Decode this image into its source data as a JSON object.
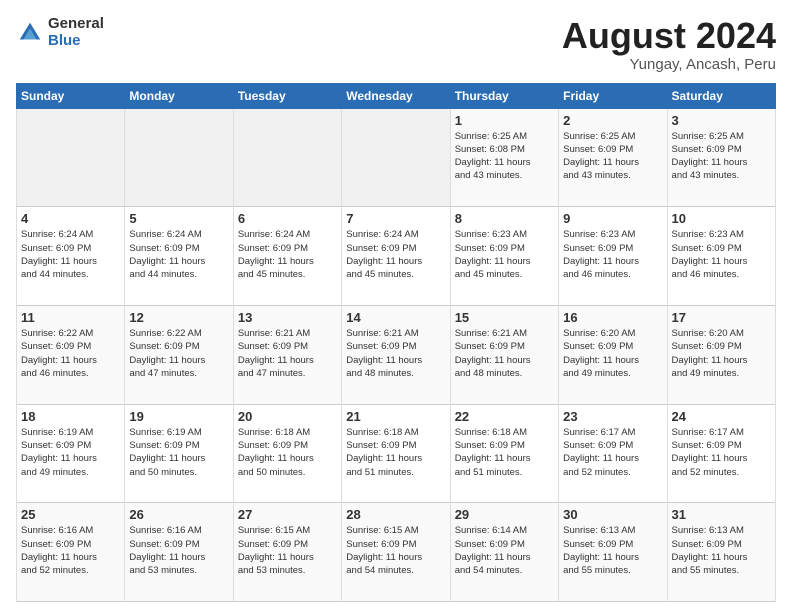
{
  "header": {
    "logo_general": "General",
    "logo_blue": "Blue",
    "main_title": "August 2024",
    "subtitle": "Yungay, Ancash, Peru"
  },
  "calendar": {
    "days_of_week": [
      "Sunday",
      "Monday",
      "Tuesday",
      "Wednesday",
      "Thursday",
      "Friday",
      "Saturday"
    ],
    "weeks": [
      [
        {
          "day": "",
          "info": "",
          "empty": true
        },
        {
          "day": "",
          "info": "",
          "empty": true
        },
        {
          "day": "",
          "info": "",
          "empty": true
        },
        {
          "day": "",
          "info": "",
          "empty": true
        },
        {
          "day": "1",
          "info": "Sunrise: 6:25 AM\nSunset: 6:08 PM\nDaylight: 11 hours\nand 43 minutes.",
          "empty": false
        },
        {
          "day": "2",
          "info": "Sunrise: 6:25 AM\nSunset: 6:09 PM\nDaylight: 11 hours\nand 43 minutes.",
          "empty": false
        },
        {
          "day": "3",
          "info": "Sunrise: 6:25 AM\nSunset: 6:09 PM\nDaylight: 11 hours\nand 43 minutes.",
          "empty": false
        }
      ],
      [
        {
          "day": "4",
          "info": "Sunrise: 6:24 AM\nSunset: 6:09 PM\nDaylight: 11 hours\nand 44 minutes.",
          "empty": false
        },
        {
          "day": "5",
          "info": "Sunrise: 6:24 AM\nSunset: 6:09 PM\nDaylight: 11 hours\nand 44 minutes.",
          "empty": false
        },
        {
          "day": "6",
          "info": "Sunrise: 6:24 AM\nSunset: 6:09 PM\nDaylight: 11 hours\nand 45 minutes.",
          "empty": false
        },
        {
          "day": "7",
          "info": "Sunrise: 6:24 AM\nSunset: 6:09 PM\nDaylight: 11 hours\nand 45 minutes.",
          "empty": false
        },
        {
          "day": "8",
          "info": "Sunrise: 6:23 AM\nSunset: 6:09 PM\nDaylight: 11 hours\nand 45 minutes.",
          "empty": false
        },
        {
          "day": "9",
          "info": "Sunrise: 6:23 AM\nSunset: 6:09 PM\nDaylight: 11 hours\nand 46 minutes.",
          "empty": false
        },
        {
          "day": "10",
          "info": "Sunrise: 6:23 AM\nSunset: 6:09 PM\nDaylight: 11 hours\nand 46 minutes.",
          "empty": false
        }
      ],
      [
        {
          "day": "11",
          "info": "Sunrise: 6:22 AM\nSunset: 6:09 PM\nDaylight: 11 hours\nand 46 minutes.",
          "empty": false
        },
        {
          "day": "12",
          "info": "Sunrise: 6:22 AM\nSunset: 6:09 PM\nDaylight: 11 hours\nand 47 minutes.",
          "empty": false
        },
        {
          "day": "13",
          "info": "Sunrise: 6:21 AM\nSunset: 6:09 PM\nDaylight: 11 hours\nand 47 minutes.",
          "empty": false
        },
        {
          "day": "14",
          "info": "Sunrise: 6:21 AM\nSunset: 6:09 PM\nDaylight: 11 hours\nand 48 minutes.",
          "empty": false
        },
        {
          "day": "15",
          "info": "Sunrise: 6:21 AM\nSunset: 6:09 PM\nDaylight: 11 hours\nand 48 minutes.",
          "empty": false
        },
        {
          "day": "16",
          "info": "Sunrise: 6:20 AM\nSunset: 6:09 PM\nDaylight: 11 hours\nand 49 minutes.",
          "empty": false
        },
        {
          "day": "17",
          "info": "Sunrise: 6:20 AM\nSunset: 6:09 PM\nDaylight: 11 hours\nand 49 minutes.",
          "empty": false
        }
      ],
      [
        {
          "day": "18",
          "info": "Sunrise: 6:19 AM\nSunset: 6:09 PM\nDaylight: 11 hours\nand 49 minutes.",
          "empty": false
        },
        {
          "day": "19",
          "info": "Sunrise: 6:19 AM\nSunset: 6:09 PM\nDaylight: 11 hours\nand 50 minutes.",
          "empty": false
        },
        {
          "day": "20",
          "info": "Sunrise: 6:18 AM\nSunset: 6:09 PM\nDaylight: 11 hours\nand 50 minutes.",
          "empty": false
        },
        {
          "day": "21",
          "info": "Sunrise: 6:18 AM\nSunset: 6:09 PM\nDaylight: 11 hours\nand 51 minutes.",
          "empty": false
        },
        {
          "day": "22",
          "info": "Sunrise: 6:18 AM\nSunset: 6:09 PM\nDaylight: 11 hours\nand 51 minutes.",
          "empty": false
        },
        {
          "day": "23",
          "info": "Sunrise: 6:17 AM\nSunset: 6:09 PM\nDaylight: 11 hours\nand 52 minutes.",
          "empty": false
        },
        {
          "day": "24",
          "info": "Sunrise: 6:17 AM\nSunset: 6:09 PM\nDaylight: 11 hours\nand 52 minutes.",
          "empty": false
        }
      ],
      [
        {
          "day": "25",
          "info": "Sunrise: 6:16 AM\nSunset: 6:09 PM\nDaylight: 11 hours\nand 52 minutes.",
          "empty": false
        },
        {
          "day": "26",
          "info": "Sunrise: 6:16 AM\nSunset: 6:09 PM\nDaylight: 11 hours\nand 53 minutes.",
          "empty": false
        },
        {
          "day": "27",
          "info": "Sunrise: 6:15 AM\nSunset: 6:09 PM\nDaylight: 11 hours\nand 53 minutes.",
          "empty": false
        },
        {
          "day": "28",
          "info": "Sunrise: 6:15 AM\nSunset: 6:09 PM\nDaylight: 11 hours\nand 54 minutes.",
          "empty": false
        },
        {
          "day": "29",
          "info": "Sunrise: 6:14 AM\nSunset: 6:09 PM\nDaylight: 11 hours\nand 54 minutes.",
          "empty": false
        },
        {
          "day": "30",
          "info": "Sunrise: 6:13 AM\nSunset: 6:09 PM\nDaylight: 11 hours\nand 55 minutes.",
          "empty": false
        },
        {
          "day": "31",
          "info": "Sunrise: 6:13 AM\nSunset: 6:09 PM\nDaylight: 11 hours\nand 55 minutes.",
          "empty": false
        }
      ]
    ]
  }
}
